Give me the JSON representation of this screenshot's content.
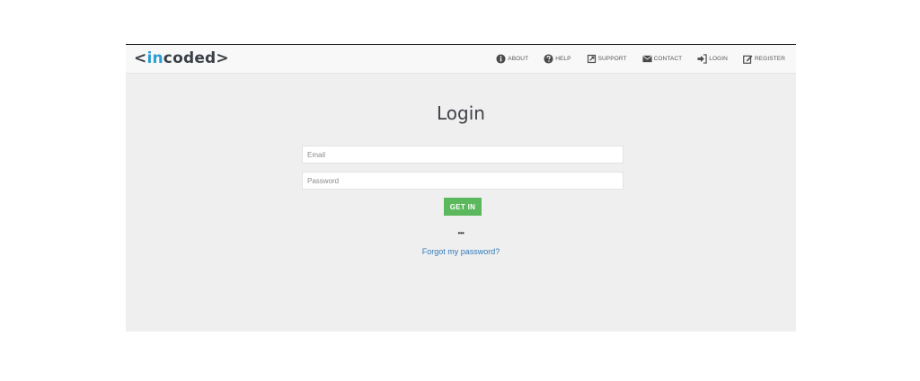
{
  "brand": {
    "logo_bracket_open": "<",
    "logo_accent": "in",
    "logo_rest": "coded",
    "logo_bracket_close": ">",
    "accent_color": "#2b9ed6"
  },
  "nav": {
    "items": [
      {
        "label": "About",
        "icon": "info-circle-icon"
      },
      {
        "label": "Help",
        "icon": "question-circle-icon"
      },
      {
        "label": "Support",
        "icon": "external-link-icon"
      },
      {
        "label": "Contact",
        "icon": "envelope-icon"
      },
      {
        "label": "Login",
        "icon": "sign-in-icon"
      },
      {
        "label": "Register",
        "icon": "edit-icon"
      }
    ]
  },
  "login": {
    "title": "Login",
    "email_placeholder": "Email",
    "password_placeholder": "Password",
    "submit_label": "GET IN",
    "submit_color": "#5cb85c",
    "separator": "•••",
    "forgot_label": "Forgot my password?",
    "link_color": "#337ab7"
  }
}
